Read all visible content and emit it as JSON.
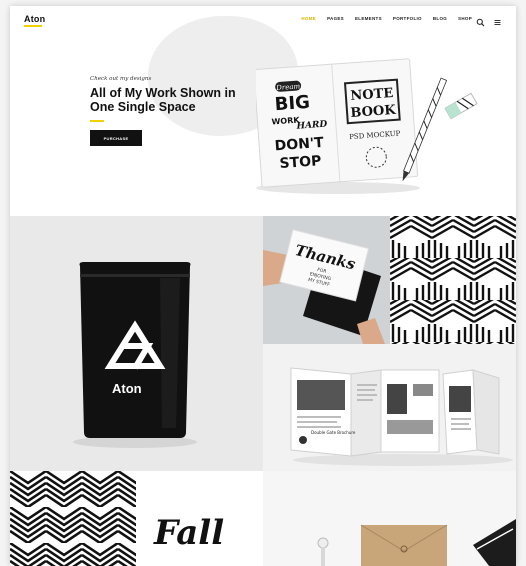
{
  "brand": {
    "name": "Aton",
    "accent": "#f2d100"
  },
  "nav": {
    "items": [
      {
        "label": "HOME",
        "active": true
      },
      {
        "label": "PAGES",
        "active": false
      },
      {
        "label": "ELEMENTS",
        "active": false
      },
      {
        "label": "PORTFOLIO",
        "active": false
      },
      {
        "label": "BLOG",
        "active": false
      },
      {
        "label": "SHOP",
        "active": false
      }
    ],
    "icons": [
      "search-icon",
      "menu-icon"
    ]
  },
  "hero": {
    "eyebrow": "Check out my designs",
    "title": "All of My Work Shown in One Single Space",
    "cta_label": "PURCHASE",
    "mockup_text": {
      "left_page": [
        "Dream",
        "BIG",
        "WORK",
        "HARD",
        "DON'T",
        "STOP"
      ],
      "right_page": [
        "NOTE",
        "BOOK",
        "PSD MOCKUP"
      ]
    }
  },
  "portfolio": {
    "bag_brand": "Aton",
    "card_text": "Thanks",
    "card_subtext": [
      "FOR",
      "ENJOYING",
      "MY STUFF"
    ],
    "brochure_text": "Double Gate Brochure",
    "script_text": "Fall"
  }
}
